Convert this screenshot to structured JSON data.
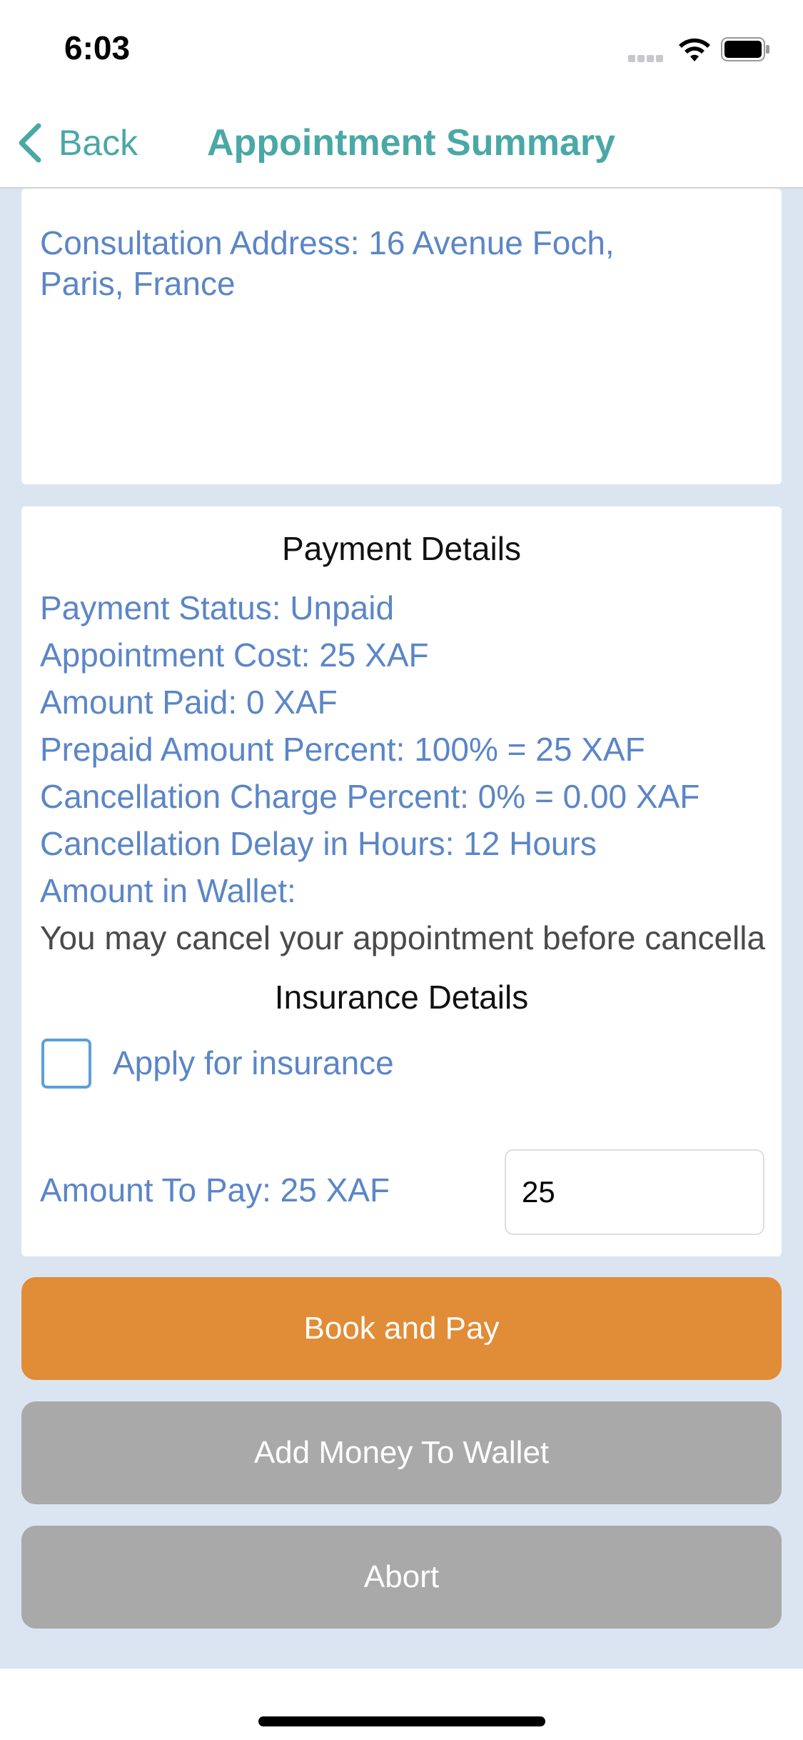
{
  "status_bar": {
    "time": "6:03"
  },
  "nav": {
    "back_label": "Back",
    "title": "Appointment Summary"
  },
  "address": {
    "line1": "Consultation Address: 16 Avenue Foch,",
    "line2": "Paris, France"
  },
  "payment": {
    "title": "Payment Details",
    "status": "Payment Status: Unpaid",
    "cost": "Appointment Cost: 25 XAF",
    "paid": "Amount Paid: 0 XAF",
    "prepaid": "Prepaid Amount Percent: 100% = 25 XAF",
    "cancellation_charge": "Cancellation Charge Percent: 0% = 0.00 XAF",
    "cancellation_delay": "Cancellation Delay in Hours: 12 Hours",
    "wallet": "Amount in Wallet:",
    "note": "You may cancel your appointment before cancella"
  },
  "insurance": {
    "title": "Insurance Details",
    "checkbox_label": "Apply for insurance",
    "checked": false
  },
  "amount_to_pay": {
    "label": "Amount To Pay: 25 XAF",
    "input_value": "25"
  },
  "buttons": {
    "book_and_pay": "Book and Pay",
    "add_money": "Add Money To Wallet",
    "abort": "Abort"
  },
  "colors": {
    "accent": "#4aa8a6",
    "link_text": "#5b86c7",
    "primary_button": "#e18c36",
    "secondary_button": "#a9a9a9",
    "background": "#dbe5f2"
  },
  "icons": [
    "cellular-signal-icon",
    "wifi-icon",
    "battery-icon",
    "chevron-left-icon"
  ]
}
